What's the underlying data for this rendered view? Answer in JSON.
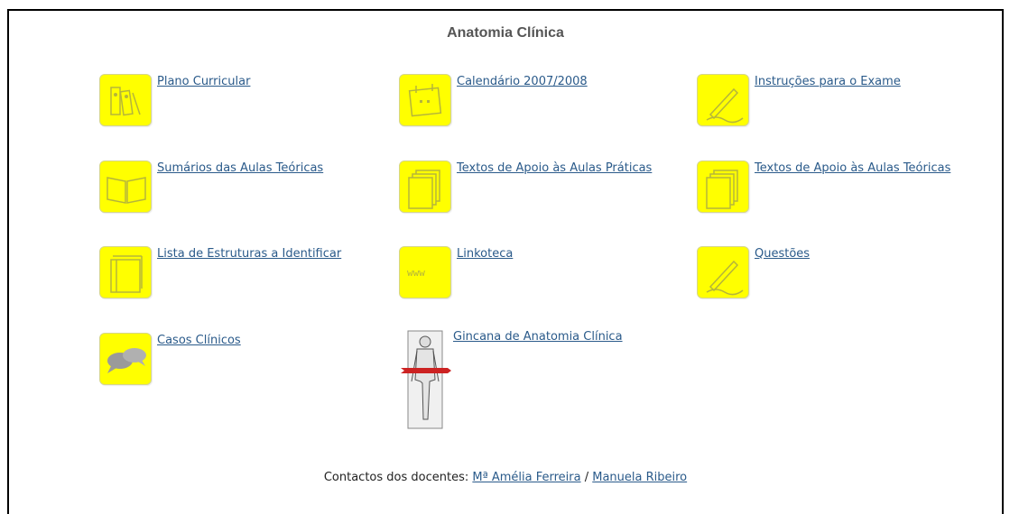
{
  "page": {
    "title": "Anatomia Clínica"
  },
  "items": [
    {
      "label": "Plano Curricular",
      "icon": "binders-icon"
    },
    {
      "label": "Calendário 2007/2008",
      "icon": "calendar-icon"
    },
    {
      "label": "Instruções para o Exame",
      "icon": "pen-icon"
    },
    {
      "label": "Sumários das Aulas Teóricas",
      "icon": "open-book-icon"
    },
    {
      "label": "Textos de Apoio às Aulas Práticas",
      "icon": "documents-icon"
    },
    {
      "label": "Textos de Apoio às Aulas Teóricas",
      "icon": "documents-icon"
    },
    {
      "label": "Lista de Estruturas a Identificar",
      "icon": "book-stack-icon"
    },
    {
      "label": "Linkoteca",
      "icon": "www-icon",
      "icon_text": "www"
    },
    {
      "label": "Questões",
      "icon": "pen-icon"
    },
    {
      "label": "Casos Clínicos",
      "icon": "speech-bubbles-icon"
    },
    {
      "label": "Gincana de Anatomia Clínica",
      "icon": "anatomy-figure-icon"
    }
  ],
  "footer": {
    "prefix": "Contactos dos docentes: ",
    "contact1": "Mª Amélia Ferreira",
    "separator": " / ",
    "contact2": "Manuela Ribeiro"
  },
  "colors": {
    "icon_bg": "#ffff00",
    "link": "#2a5a8a",
    "title": "#555555"
  }
}
